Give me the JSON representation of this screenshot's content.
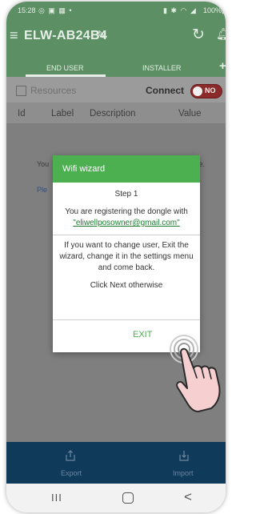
{
  "status_bar": {
    "time": "15:28",
    "left_icons": "◎ ▣ ▦ •",
    "right_icons": "▮ ✱ ◠ ◢",
    "battery": "100%▮"
  },
  "app_bar": {
    "title": "ELW-AB24B4"
  },
  "tabs": [
    {
      "label": "END USER"
    },
    {
      "label": "INSTALLER"
    }
  ],
  "tab_plus": "+",
  "toolbar": {
    "resources_label": "Resources",
    "connect_label": "Connect",
    "toggle_text": "NO"
  },
  "table_header": {
    "id": "Id",
    "label": "Label",
    "description": "Description",
    "value": "Value"
  },
  "background": {
    "text_left": "You",
    "text_right": "ce.",
    "link_text": "Ple"
  },
  "dialog": {
    "title": "Wifi wizard",
    "step": "Step 1",
    "registering": "You are registering the dongle with",
    "email": "\"eliwellposowner@gmail.com\"",
    "change_user": "If you want to change user, Exit the wizard, change it in the settings menu and come back.",
    "next_hint": "Click Next otherwise",
    "exit_label": "EXIT"
  },
  "bottom_bar": {
    "export_label": "Export",
    "import_label": "Import"
  },
  "nav_bar": {
    "recents": "III",
    "back": "<"
  },
  "colors": {
    "app_green": "#5c8f63",
    "dialog_green": "#4caf50",
    "bottom_bar_blue": "#0f3a5a"
  }
}
